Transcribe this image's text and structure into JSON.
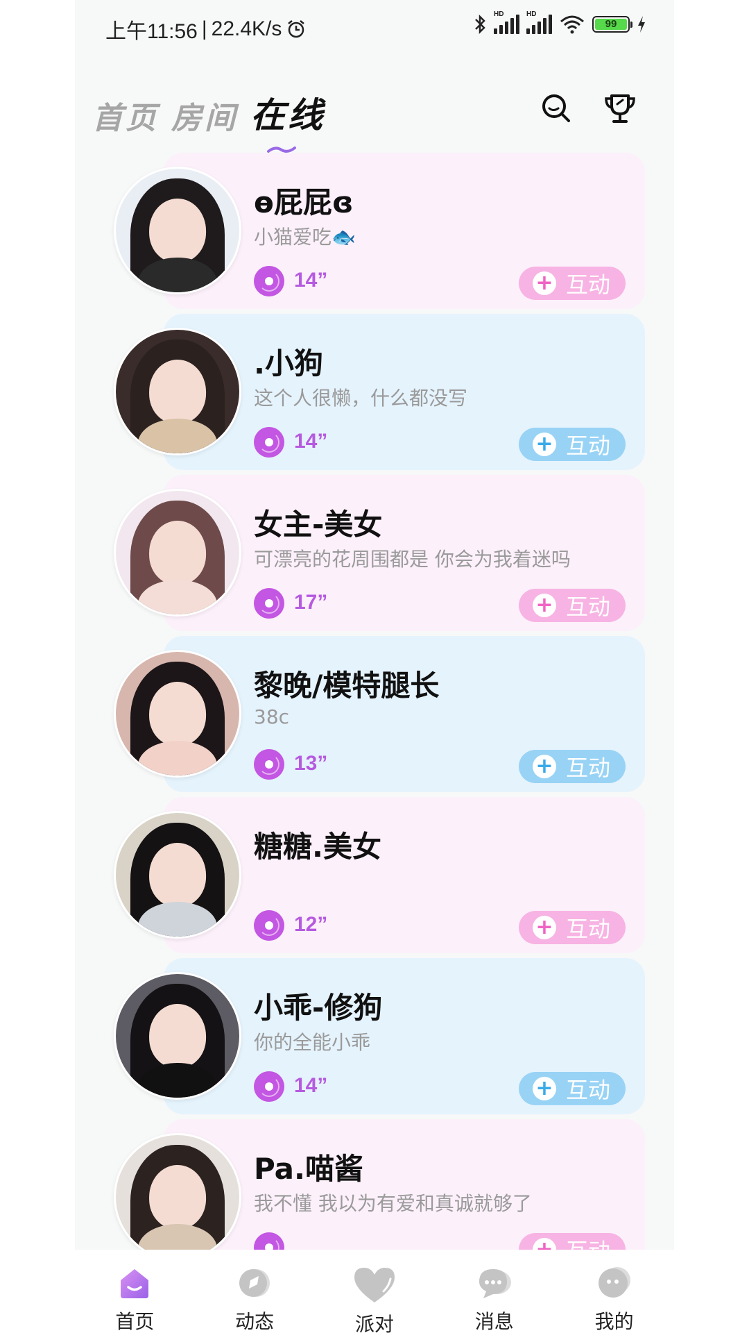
{
  "status_bar": {
    "time": "上午11:56",
    "speed": "22.4K/s",
    "hd1": "HD",
    "hd2": "HD",
    "battery": "99"
  },
  "header": {
    "tabs": [
      {
        "label": "首页",
        "active": false
      },
      {
        "label": "房间",
        "active": false
      },
      {
        "label": "在线",
        "active": true
      }
    ],
    "icons": [
      "search-icon",
      "trophy-icon"
    ]
  },
  "colors": {
    "pink_card": "#fcf0fa",
    "blue_card": "#e5f3fd",
    "pink_button": "#f7b3e3",
    "blue_button": "#98d3f5",
    "accent_purple": "#c356e2"
  },
  "users": [
    {
      "name": "ɵ屁屁ɞ",
      "bio": "小猫爱吃🐟",
      "duration": "14”",
      "theme": "pink",
      "action": "互动"
    },
    {
      "name": ".小狗",
      "bio": "这个人很懒，什么都没写",
      "duration": "14”",
      "theme": "blue",
      "action": "互动"
    },
    {
      "name": "女主-美女",
      "bio": "可漂亮的花周围都是 你会为我着迷吗",
      "duration": "17”",
      "theme": "pink",
      "action": "互动"
    },
    {
      "name": "黎晚/模特腿长",
      "bio": "38c",
      "duration": "13”",
      "theme": "blue",
      "action": "互动"
    },
    {
      "name": "糖糖.美女",
      "bio": "",
      "duration": "12”",
      "theme": "pink",
      "action": "互动"
    },
    {
      "name": "小乖-修狗",
      "bio": "你的全能小乖",
      "duration": "14”",
      "theme": "blue",
      "action": "互动"
    },
    {
      "name": "Pa.喵酱",
      "bio": "我不懂 我以为有爱和真诚就够了",
      "duration": "",
      "theme": "pink",
      "action": "互动"
    }
  ],
  "bottom_nav": [
    {
      "label": "首页",
      "icon": "home-icon",
      "active": true
    },
    {
      "label": "动态",
      "icon": "moments-icon",
      "active": false
    },
    {
      "label": "派对",
      "icon": "party-heart-icon",
      "active": false
    },
    {
      "label": "消息",
      "icon": "message-icon",
      "active": false
    },
    {
      "label": "我的",
      "icon": "profile-icon",
      "active": false
    }
  ]
}
